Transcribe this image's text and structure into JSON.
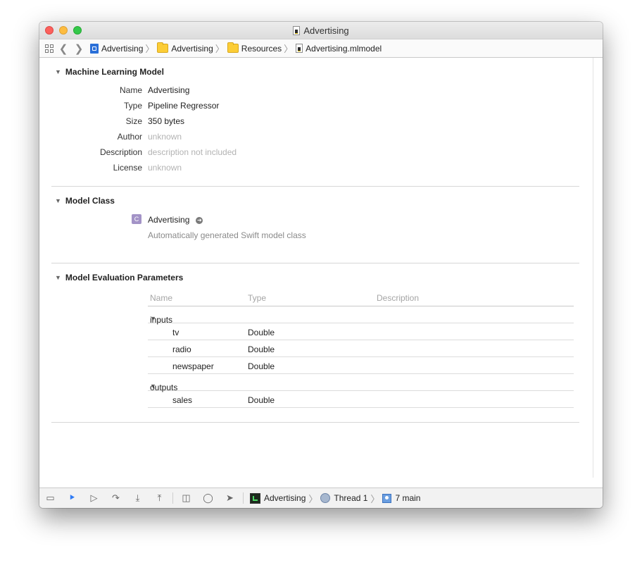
{
  "window": {
    "title": "Advertising"
  },
  "jumpbar": {
    "crumbs": [
      "Advertising",
      "Advertising",
      "Resources",
      "Advertising.mlmodel"
    ]
  },
  "model": {
    "section_title": "Machine Learning Model",
    "properties": [
      {
        "label": "Name",
        "value": "Advertising"
      },
      {
        "label": "Type",
        "value": "Pipeline Regressor"
      },
      {
        "label": "Size",
        "value": "350 bytes"
      },
      {
        "label": "Author",
        "value": "unknown"
      },
      {
        "label": "Description",
        "value": "description not included"
      },
      {
        "label": "License",
        "value": "unknown"
      }
    ]
  },
  "model_class": {
    "section_title": "Model Class",
    "badge": "C",
    "class_name": "Advertising",
    "description": "Automatically generated Swift model class"
  },
  "evaluation": {
    "section_title": "Model Evaluation Parameters",
    "columns": [
      "Name",
      "Type",
      "Description"
    ],
    "groups": [
      {
        "name": "inputs",
        "items": [
          {
            "name": "tv",
            "type": "Double",
            "description": ""
          },
          {
            "name": "radio",
            "type": "Double",
            "description": ""
          },
          {
            "name": "newspaper",
            "type": "Double",
            "description": ""
          }
        ]
      },
      {
        "name": "outputs",
        "items": [
          {
            "name": "sales",
            "type": "Double",
            "description": ""
          }
        ]
      }
    ]
  },
  "debugbar": {
    "crumbs": [
      "Advertising",
      "Thread 1",
      "7 main"
    ]
  },
  "colors": {
    "close": "#fc605c",
    "minimize": "#fdbc40",
    "zoom": "#34c84a",
    "accent": "#2f7bf5",
    "dim_text": "#b3b3b3"
  }
}
